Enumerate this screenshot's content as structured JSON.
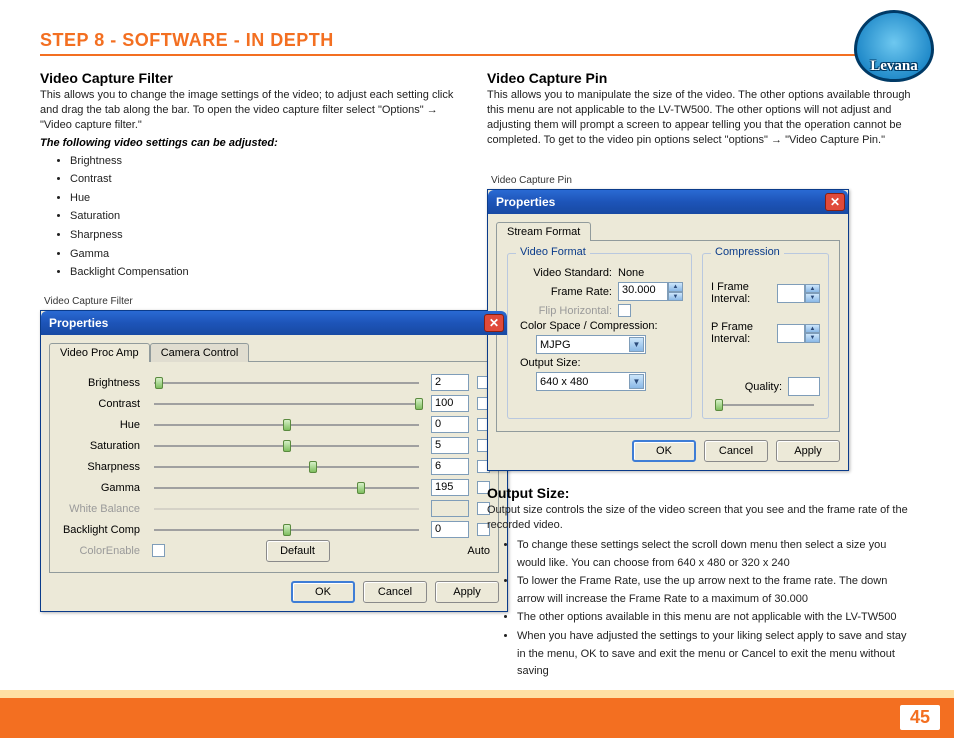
{
  "step_header": "STEP 8   - SOFTWARE - IN DEPTH",
  "page_number": "45",
  "logo_text": "Levana",
  "left": {
    "title": "Video Capture Filter",
    "desc": "This allows you to change the image settings of the video; to adjust each setting click and drag the tab along the bar. To open the video capture filter select \"Options\" → \"Video capture filter.\"",
    "note": "The following video settings can be adjusted:",
    "bullets": [
      "Brightness",
      "Contrast",
      "Hue",
      "Saturation",
      "Sharpness",
      "Gamma",
      "Backlight Compensation"
    ],
    "caption": "Video Capture Filter"
  },
  "right": {
    "title": "Video Capture Pin",
    "desc": "This allows you to manipulate the size of the video. The other options available through this menu are not applicable to the LV-TW500. The other options will not adjust and adjusting them will prompt a screen to appear telling you that the operation cannot be completed. To get to the video pin options select \"options\" → \"Video Capture Pin.\"",
    "caption": "Video Capture Pin",
    "output_title": "Output Size:",
    "output_desc": "Output size controls the size of the video screen that you see and the frame rate of the recorded video.",
    "output_bullets": [
      "To change these settings select the scroll down menu then select a size you would like. You can choose from 640 x 480 or 320 x 240",
      "To lower the Frame Rate, use the up arrow next to the frame rate. The down arrow will increase the Frame Rate to a maximum of 30.000",
      "The other options available in this menu are not applicable with the LV-TW500",
      "When you have adjusted the settings to your liking select apply to save and stay in the menu, OK to save and exit the menu or Cancel to exit the menu without saving"
    ]
  },
  "dlg1": {
    "title": "Properties",
    "tab1": "Video Proc Amp",
    "tab2": "Camera Control",
    "auto_label": "Auto",
    "rows": [
      {
        "label": "Brightness",
        "val": "2",
        "pos": 2,
        "enabled": true
      },
      {
        "label": "Contrast",
        "val": "100",
        "pos": 100,
        "enabled": true
      },
      {
        "label": "Hue",
        "val": "0",
        "pos": 50,
        "enabled": true
      },
      {
        "label": "Saturation",
        "val": "5",
        "pos": 50,
        "enabled": true
      },
      {
        "label": "Sharpness",
        "val": "6",
        "pos": 60,
        "enabled": true
      },
      {
        "label": "Gamma",
        "val": "195",
        "pos": 78,
        "enabled": true
      },
      {
        "label": "White Balance",
        "val": "",
        "pos": 0,
        "enabled": false
      },
      {
        "label": "Backlight Comp",
        "val": "0",
        "pos": 50,
        "enabled": true
      },
      {
        "label": "ColorEnable",
        "val": "",
        "pos": null,
        "enabled": false
      }
    ],
    "default_btn": "Default",
    "ok": "OK",
    "cancel": "Cancel",
    "apply": "Apply"
  },
  "dlg2": {
    "title": "Properties",
    "tab1": "Stream Format",
    "group1": "Video Format",
    "group2": "Compression",
    "video_standard_label": "Video Standard:",
    "video_standard_val": "None",
    "frame_rate_label": "Frame Rate:",
    "frame_rate_val": "30.000",
    "flip_label": "Flip Horizontal:",
    "csc_label": "Color Space / Compression:",
    "csc_val": "MJPG",
    "output_size_label": "Output Size:",
    "output_size_val": "640 x 480",
    "iframe_label": "I Frame Interval:",
    "pframe_label": "P Frame Interval:",
    "quality_label": "Quality:",
    "ok": "OK",
    "cancel": "Cancel",
    "apply": "Apply"
  }
}
